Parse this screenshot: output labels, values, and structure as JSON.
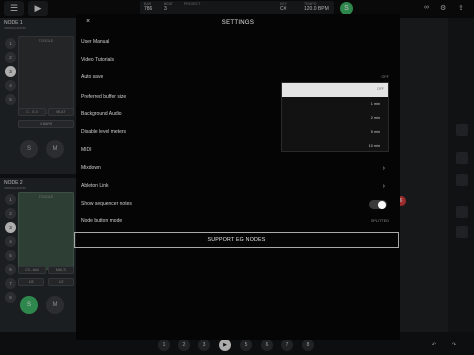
{
  "topbar": {
    "menu_icon": "menu-icon",
    "play_icon": "play-icon",
    "bar_label": "BAR",
    "bar_value": "786",
    "beat_label": "BEAT",
    "beat_value": "3",
    "project_label": "PROJECT",
    "project_value": "",
    "key_label": "KEY",
    "key_value": "C#",
    "tempo_label": "TEMPO",
    "tempo_value": "120.0 BPM",
    "master_label": "S"
  },
  "node1": {
    "title": "NODE 1",
    "subtitle": "ARPEGGIATOR",
    "pad_label": "TOGGLE",
    "numbers": [
      "1",
      "2",
      "3",
      "4",
      "5"
    ],
    "chips": [
      "C - G 4",
      "MULT",
      "4 BARS"
    ],
    "buttons": [
      "S",
      "M"
    ]
  },
  "node2": {
    "title": "NODE 2",
    "subtitle": "ARPEGGIATOR",
    "pad_label": "TOGGLE",
    "numbers": [
      "1",
      "2",
      "3",
      "4",
      "5",
      "6",
      "7",
      "8"
    ],
    "chips": [
      "C3 - A#4",
      "MULTI",
      "1/8",
      "1/2"
    ],
    "buttons": [
      "S",
      "M"
    ]
  },
  "side": {
    "red_badge": "6"
  },
  "pages": [
    "1",
    "2",
    "3",
    "5",
    "6",
    "7",
    "8"
  ],
  "settings": {
    "title": "SETTINGS",
    "close": "×",
    "rows": {
      "user_manual": "User Manual",
      "video_tutorials": "Video Tutorials",
      "auto_save": "Auto save",
      "auto_save_value": "OFF",
      "buffer_size": "Preferred buffer size",
      "background_audio": "Background Audio",
      "disable_meters": "Disable level meters",
      "midi": "MIDI",
      "mixdown": "Mixdown",
      "ableton_link": "Ableton Link",
      "show_seq_notes": "Show sequencer notes",
      "node_button_mode": "Node button mode",
      "node_button_mode_value": "SPLITTED"
    },
    "dropdown_options": [
      "OFF",
      "1 min",
      "2 min",
      "5 min",
      "10 min"
    ],
    "support_button": "SUPPORT EG NODES"
  }
}
